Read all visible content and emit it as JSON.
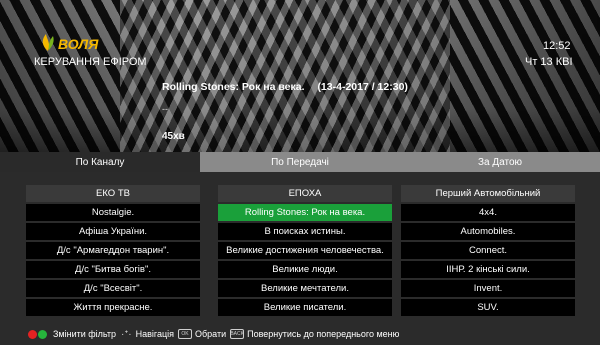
{
  "header": {
    "logo_text": "ВОЛЯ",
    "section_title": "КЕРУВАННЯ ЕФІРОМ",
    "time": "12:52",
    "date": "Чт 13 КВІ"
  },
  "program": {
    "title": "Rolling Stones: Рок на века.",
    "datetime": "(13-4-2017 / 12:30)",
    "description": "--",
    "duration": "45хв"
  },
  "tabs": [
    {
      "label": "По Каналу",
      "active": true
    },
    {
      "label": "По Передачі",
      "active": false
    },
    {
      "label": "За Датою",
      "active": false
    }
  ],
  "columns": [
    {
      "header": "ЕКО ТВ",
      "items": [
        "Nostalgie.",
        "Афіша України.",
        "Д/с \"Армагеддон тварин\".",
        "Д/с \"Битва богів\".",
        "Д/с \"Всесвіт\".",
        "Життя прекрасне."
      ]
    },
    {
      "header": "ЕПОХА",
      "items": [
        "Rolling Stones: Рок на века.",
        "В поисках истины.",
        "Великие достижения человечества.",
        "Великие люди.",
        "Великие мечтатели.",
        "Великие писатели."
      ],
      "selected_index": 0
    },
    {
      "header": "Перший Автомобільний",
      "items": [
        "4x4.",
        "Automobiles.",
        "Connect.",
        "ІІНР. 2 кінські сили.",
        "Invent.",
        "SUV."
      ]
    }
  ],
  "footer": {
    "filter_label": "Змінити фільтр",
    "nav_label": "Навігація",
    "ok_key": "OK",
    "select_label": "Обрати",
    "back_key": "BACK",
    "back_label": "Повернутись до попереднього меню",
    "colors": {
      "red": "#e32222",
      "green": "#26b53c"
    }
  }
}
